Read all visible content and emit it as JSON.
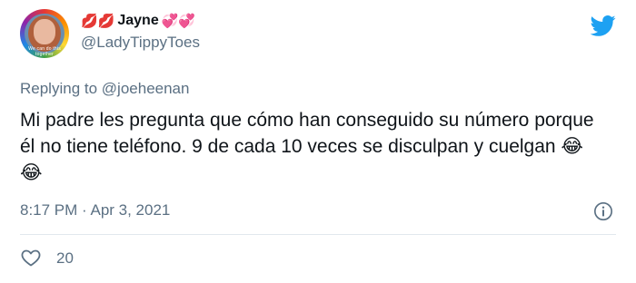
{
  "tweet": {
    "display_name": "Jayne",
    "name_emoji_left": "💋💋",
    "name_emoji_right": "💞💞",
    "username": "@LadyTippyToes",
    "avatar_ring_text": "We can do this together",
    "replying_prefix": "Replying to",
    "replying_handle": "@joeheenan",
    "text": "Mi padre les pregunta que cómo han conseguido su número porque él no tiene teléfono. 9 de cada 10 veces se disculpan y cuelgan  😂😂",
    "timestamp": "8:17 PM · Apr 3, 2021",
    "likes": "20"
  },
  "icons": {
    "brand": "twitter-bird-icon",
    "info": "info-icon",
    "like": "heart-icon"
  },
  "colors": {
    "brand": "#1da1f2",
    "secondary_text": "#5b7083",
    "primary_text": "#0f1419",
    "divider": "#e1e8ed"
  }
}
